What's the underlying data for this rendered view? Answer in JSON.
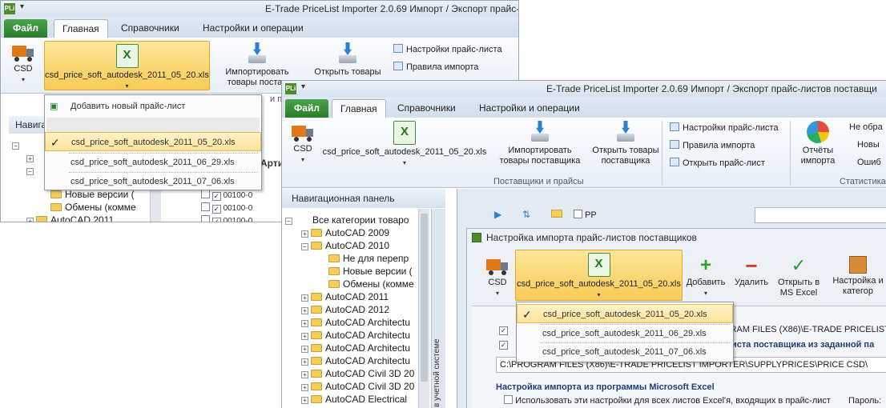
{
  "window1": {
    "app_icon": "PLi",
    "title": "E-Trade PriceList Importer 2.0.69     Импорт / Экспорт прайс-",
    "file_tab": "Файл",
    "tabs": [
      "Главная",
      "Справочники",
      "Настройки и операции"
    ],
    "ribbon": {
      "csd_label": "CSD",
      "pricelist_label": "csd_price_soft_autodesk_2011_05_20.xls",
      "import_label_1": "Импортировать",
      "import_label_2": "товары постав",
      "open_goods_label": "Открыть товары",
      "small_cmds": [
        "Настройки прайс-листа",
        "Правила импорта"
      ],
      "group_tail": "и п"
    },
    "dropdown": {
      "add_new": "Добавить новый прайс-лист",
      "items": [
        "csd_price_soft_autodesk_2011_05_20.xls",
        "csd_price_soft_autodesk_2011_06_29.xls",
        "csd_price_soft_autodesk_2011_07_06.xls"
      ],
      "selected_index": 0
    },
    "nav_header": "Навига",
    "tree": [
      "Новые версии (",
      "Обмены (комме",
      "AutoCAD 2011"
    ],
    "grid": {
      "col_header": "Арти",
      "codes": [
        "00100-0",
        "00100-0",
        "00100-0"
      ]
    }
  },
  "window2": {
    "app_icon": "PLi",
    "title": "E-Trade PriceList Importer 2.0.69    Импорт / Экспорт прайс-листов поставщи",
    "file_tab": "Файл",
    "tabs": [
      "Главная",
      "Справочники",
      "Настройки и операции"
    ],
    "ribbon": {
      "csd_label": "CSD",
      "pricelist_label": "csd_price_soft_autodesk_2011_05_20.xls",
      "import_label_1": "Импортировать",
      "import_label_2": "товары поставщика",
      "open_goods_label_1": "Открыть товары",
      "open_goods_label_2": "поставщика",
      "group_label": "Поставщики и прайсы",
      "small_cmds": [
        "Настройки прайс-листа",
        "Правила импорта",
        "Открыть прайс-лист"
      ],
      "reports_label_1": "Отчёты",
      "reports_label_2": "импорта",
      "right_items": [
        "Не обра",
        "Новы",
        "Ошиб"
      ],
      "right_group_label": "Статистика"
    },
    "nav_header": "Навигационная панель",
    "vertical_tab": "в учетной системе",
    "tree": [
      {
        "label": "Все категории товаро",
        "level": 0,
        "toggle": "−"
      },
      {
        "label": "AutoCAD 2009",
        "level": 1,
        "toggle": "+"
      },
      {
        "label": "AutoCAD 2010",
        "level": 1,
        "toggle": "−"
      },
      {
        "label": "Не для перепр",
        "level": 2,
        "toggle": ""
      },
      {
        "label": "Новые версии (",
        "level": 2,
        "toggle": ""
      },
      {
        "label": "Обмены (комме",
        "level": 2,
        "toggle": ""
      },
      {
        "label": "AutoCAD 2011",
        "level": 1,
        "toggle": "+"
      },
      {
        "label": "AutoCAD 2012",
        "level": 1,
        "toggle": "+"
      },
      {
        "label": "AutoCAD Architectu",
        "level": 1,
        "toggle": "+"
      },
      {
        "label": "AutoCAD Architectu",
        "level": 1,
        "toggle": "+"
      },
      {
        "label": "AutoCAD Architectu",
        "level": 1,
        "toggle": "+"
      },
      {
        "label": "AutoCAD Architectu",
        "level": 1,
        "toggle": "+"
      },
      {
        "label": "AutoCAD Civil 3D 20",
        "level": 1,
        "toggle": "+"
      },
      {
        "label": "AutoCAD Civil 3D 20",
        "level": 1,
        "toggle": "+"
      },
      {
        "label": "AutoCAD Electrical",
        "level": 1,
        "toggle": "+"
      }
    ],
    "toolbar": {
      "pp_label": "PP"
    },
    "panel": {
      "title": "Настройка импорта прайс-листов поставщиков",
      "csd_label": "CSD",
      "pricelist_label": "csd_price_soft_autodesk_2011_05_20.xls",
      "add_label": "Добавить",
      "delete_label": "Удалить",
      "open_excel_1": "Открыть в",
      "open_excel_2": "MS Excel",
      "settings_cat_1": "Настройка и",
      "settings_cat_2": "категор",
      "path_partial": "GRAM FILES (X86)\\E-TRADE PRICELIST I",
      "bold_line": "иста поставщика из заданной па",
      "path_full": "C:\\PROGRAM FILES (X86)\\E-TRADE PRICELIST IMPORTER\\SUPPLYPRICES\\PRICE CSD\\",
      "excel_section": "Настройка импорта из программы Microsoft Excel",
      "checkbox_label": "Использовать эти настройки для всех листов Excel'я, входящих в прайс-лист",
      "password_label": "Пароль:"
    },
    "dropdown": {
      "items": [
        "csd_price_soft_autodesk_2011_05_20.xls",
        "csd_price_soft_autodesk_2011_06_29.xls",
        "csd_price_soft_autodesk_2011_07_06.xls"
      ],
      "selected_index": 0
    }
  },
  "colors": {
    "file_tab": "#2a7d2a",
    "selection": "#fde39a",
    "accent_blue": "#1e3d7a"
  }
}
